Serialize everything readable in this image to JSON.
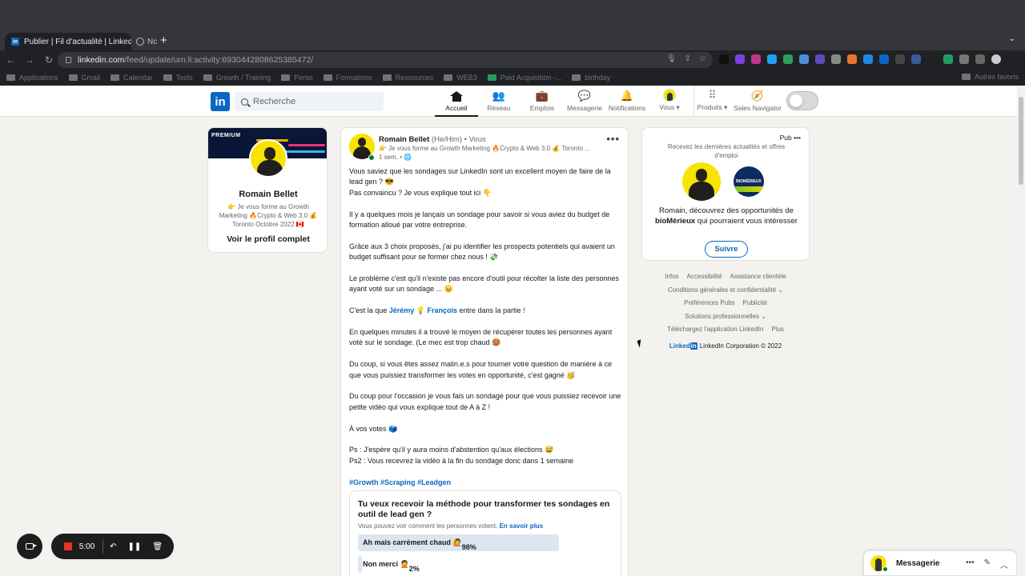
{
  "browser": {
    "active_tab_title": "Publier | Fil d’actualité | LinkedIn",
    "inactive_tab_title": "Nc",
    "url_host": "linkedin.com",
    "url_path": "/feed/update/urn:li:activity:6930442808625385472/",
    "bookmarks": [
      "Applications",
      "Gmail",
      "Calendar",
      "Tools",
      "Growth / Training",
      "Perso",
      "Formations",
      "Ressources",
      "WEB3",
      "Paid Acquisition -...",
      "birthday"
    ],
    "other_bookmarks": "Autres favoris"
  },
  "header": {
    "logo": "in",
    "search_placeholder": "Recherche",
    "nav": [
      {
        "label": "Accueil",
        "icon": "home-icon"
      },
      {
        "label": "Réseau",
        "icon": "network-icon"
      },
      {
        "label": "Emplois",
        "icon": "jobs-icon"
      },
      {
        "label": "Messagerie",
        "icon": "messaging-icon"
      },
      {
        "label": "Notifications",
        "icon": "bell-icon"
      },
      {
        "label": "Vous",
        "icon": "avatar"
      },
      {
        "label": "Produits",
        "icon": "grid-icon"
      },
      {
        "label": "Sales Navigator",
        "icon": "compass-icon"
      }
    ]
  },
  "profile": {
    "banner_label": "PREMIUM",
    "name": "Romain Bellet",
    "headline": "👉 Je vous forme au Growth Marketing 🔥Crypto & Web 3.0 💰 Toronto Octobre 2022 🇨🇦",
    "view_profile": "Voir le profil complet"
  },
  "post": {
    "author": "Romain Bellet",
    "pronouns": "(He/Him)",
    "relation": "• Vous",
    "headline": "👉 Je vous forme au Growth Marketing 🔥Crypto & Web 3.0 💰 Toronto ...",
    "time": "1 sem. •",
    "paragraphs": [
      "Vous saviez que les sondages sur LinkedIn sont un excellent moyen de faire de la lead gen ? 😎\nPas convaincu ? Je vous explique tout ici 👇",
      "Il y a quelques mois je lançais un sondage pour savoir si vous aviez du budget de formation alloué par votre entreprise.",
      "Grâce aux 3 choix proposés, j'ai pu identifier les prospects potentiels qui avaient un budget suffisant pour se former chez nous ! 💸",
      "Le problème c'est qu'il n'existe pas encore d'outil pour récolter la liste des personnes ayant voté sur un sondage ... 😠"
    ],
    "mention_before": "C'est la que ",
    "mention": "Jérémy 💡 François",
    "mention_after": " entre dans la partie !",
    "paragraphs2": [
      "En quelques minutes il a trouvé le moyen de récupérer toutes les personnes ayant voté sur le sondage. (Le mec est trop chaud 🥵",
      "Du coup, si vous êtes assez malin.e.s pour tourner votre question de manière à ce que vous puissiez transformer les votes en opportunité, c'est gagné 🥳",
      "Du coup pour l'occasion je vous fais un sondage pour que vous puissiez recevoir une petite vidéo qui vous explique tout de A à Z !",
      "À vos votes 🗳️",
      "Ps : J'espère qu'il y aura moins d'abstention qu'aux élections 😅\nPs2 : Vous recevrez la vidéo à la fin du sondage donc dans 1 semaine"
    ],
    "hashtags": "#Growth #Scraping #Leadgen",
    "poll": {
      "question": "Tu veux recevoir la méthode pour transformer tes sondages en outil de lead gen ?",
      "meta": "Vous pouvez voir comment les personnes votent.",
      "meta_link": "En savoir plus",
      "options": [
        {
          "label": "Ah mais carrément chaud 🙋",
          "pct": "98%",
          "value": 0.98
        },
        {
          "label": "Non merci 🤦",
          "pct": "2%",
          "value": 0.02
        }
      ]
    }
  },
  "ad": {
    "pub": "Pub",
    "subtitle": "Recevez les dernières actualités et offres d'emploi",
    "text_before": "Romain, découvrez des opportunités de ",
    "company": "bioMérieux",
    "text_after": " qui pourraient vous intéresser",
    "company_logo_text": "BIOMÉRIEUX",
    "follow": "Suivre"
  },
  "footer": {
    "links": [
      "Infos",
      "Accessibilité",
      "Assistance clientèle",
      "Conditions générales et confidentialité ⌄",
      "Préférences Pubs",
      "Publicité",
      "Solutions professionnelles ⌄",
      "Téléchargez l'application LinkedIn",
      "Plus"
    ],
    "brand_word": "Linked",
    "brand_in": "in",
    "copyright": "LinkedIn Corporation © 2022"
  },
  "recorder": {
    "time": "5:00"
  },
  "messaging": {
    "label": "Messagerie"
  }
}
